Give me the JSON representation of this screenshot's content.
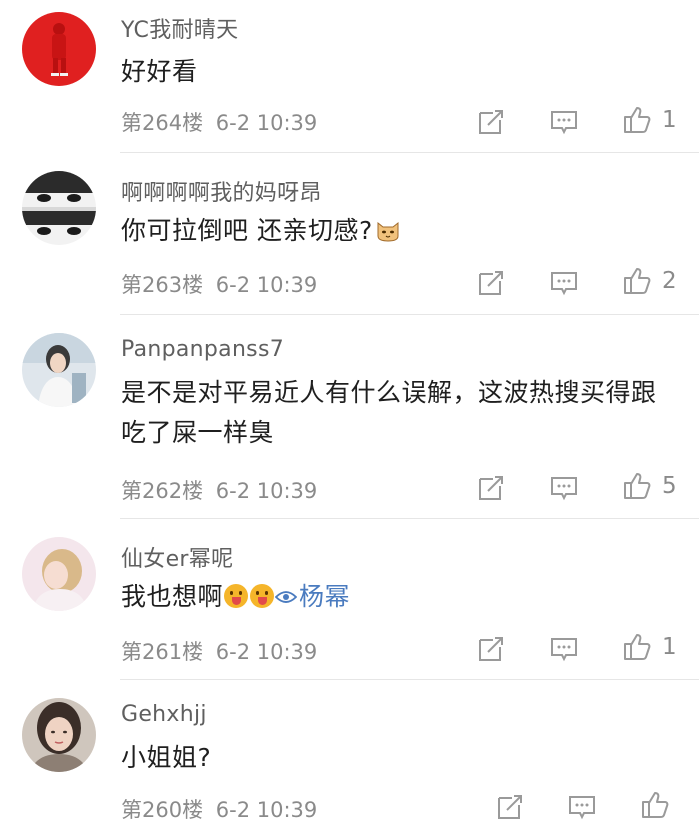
{
  "comments": [
    {
      "username": "YC我耐晴天",
      "content": "好好看",
      "floor": "第264楼",
      "time": "6-2 10:39",
      "likes": "1",
      "avatar_icon": "red-figure-avatar"
    },
    {
      "username": "啊啊啊啊我的妈呀昂",
      "content": "你可拉倒吧 还亲切感?",
      "floor": "第263楼",
      "time": "6-2 10:39",
      "likes": "2",
      "avatar_icon": "eyes-avatar",
      "trailing_emoji": "cat-face-emoji"
    },
    {
      "username": "Panpanpanss7",
      "content": "是不是对平易近人有什么误解，这波热搜买得跟吃了屎一样臭",
      "floor": "第262楼",
      "time": "6-2 10:39",
      "likes": "5",
      "avatar_icon": "girl-photo-avatar"
    },
    {
      "username": "仙女er幂呢",
      "content": "我也想啊",
      "mention": "杨幂",
      "floor": "第261楼",
      "time": "6-2 10:39",
      "likes": "1",
      "avatar_icon": "blonde-girl-avatar",
      "trailing_emoji": "tongue-face-emoji"
    },
    {
      "username": "Gehxhjj",
      "content": "小姐姐?",
      "floor": "第260楼",
      "time": "6-2 10:39",
      "likes": "",
      "avatar_icon": "face-photo-avatar"
    }
  ],
  "colors": {
    "username": "#5f5f5f",
    "meta": "#8a8a8a",
    "mention": "#4a7bbf",
    "divider": "#e6e6e6"
  },
  "icons": {
    "repost": "share-edit-icon",
    "reply": "comment-bubble-icon",
    "like": "thumbs-up-icon"
  }
}
